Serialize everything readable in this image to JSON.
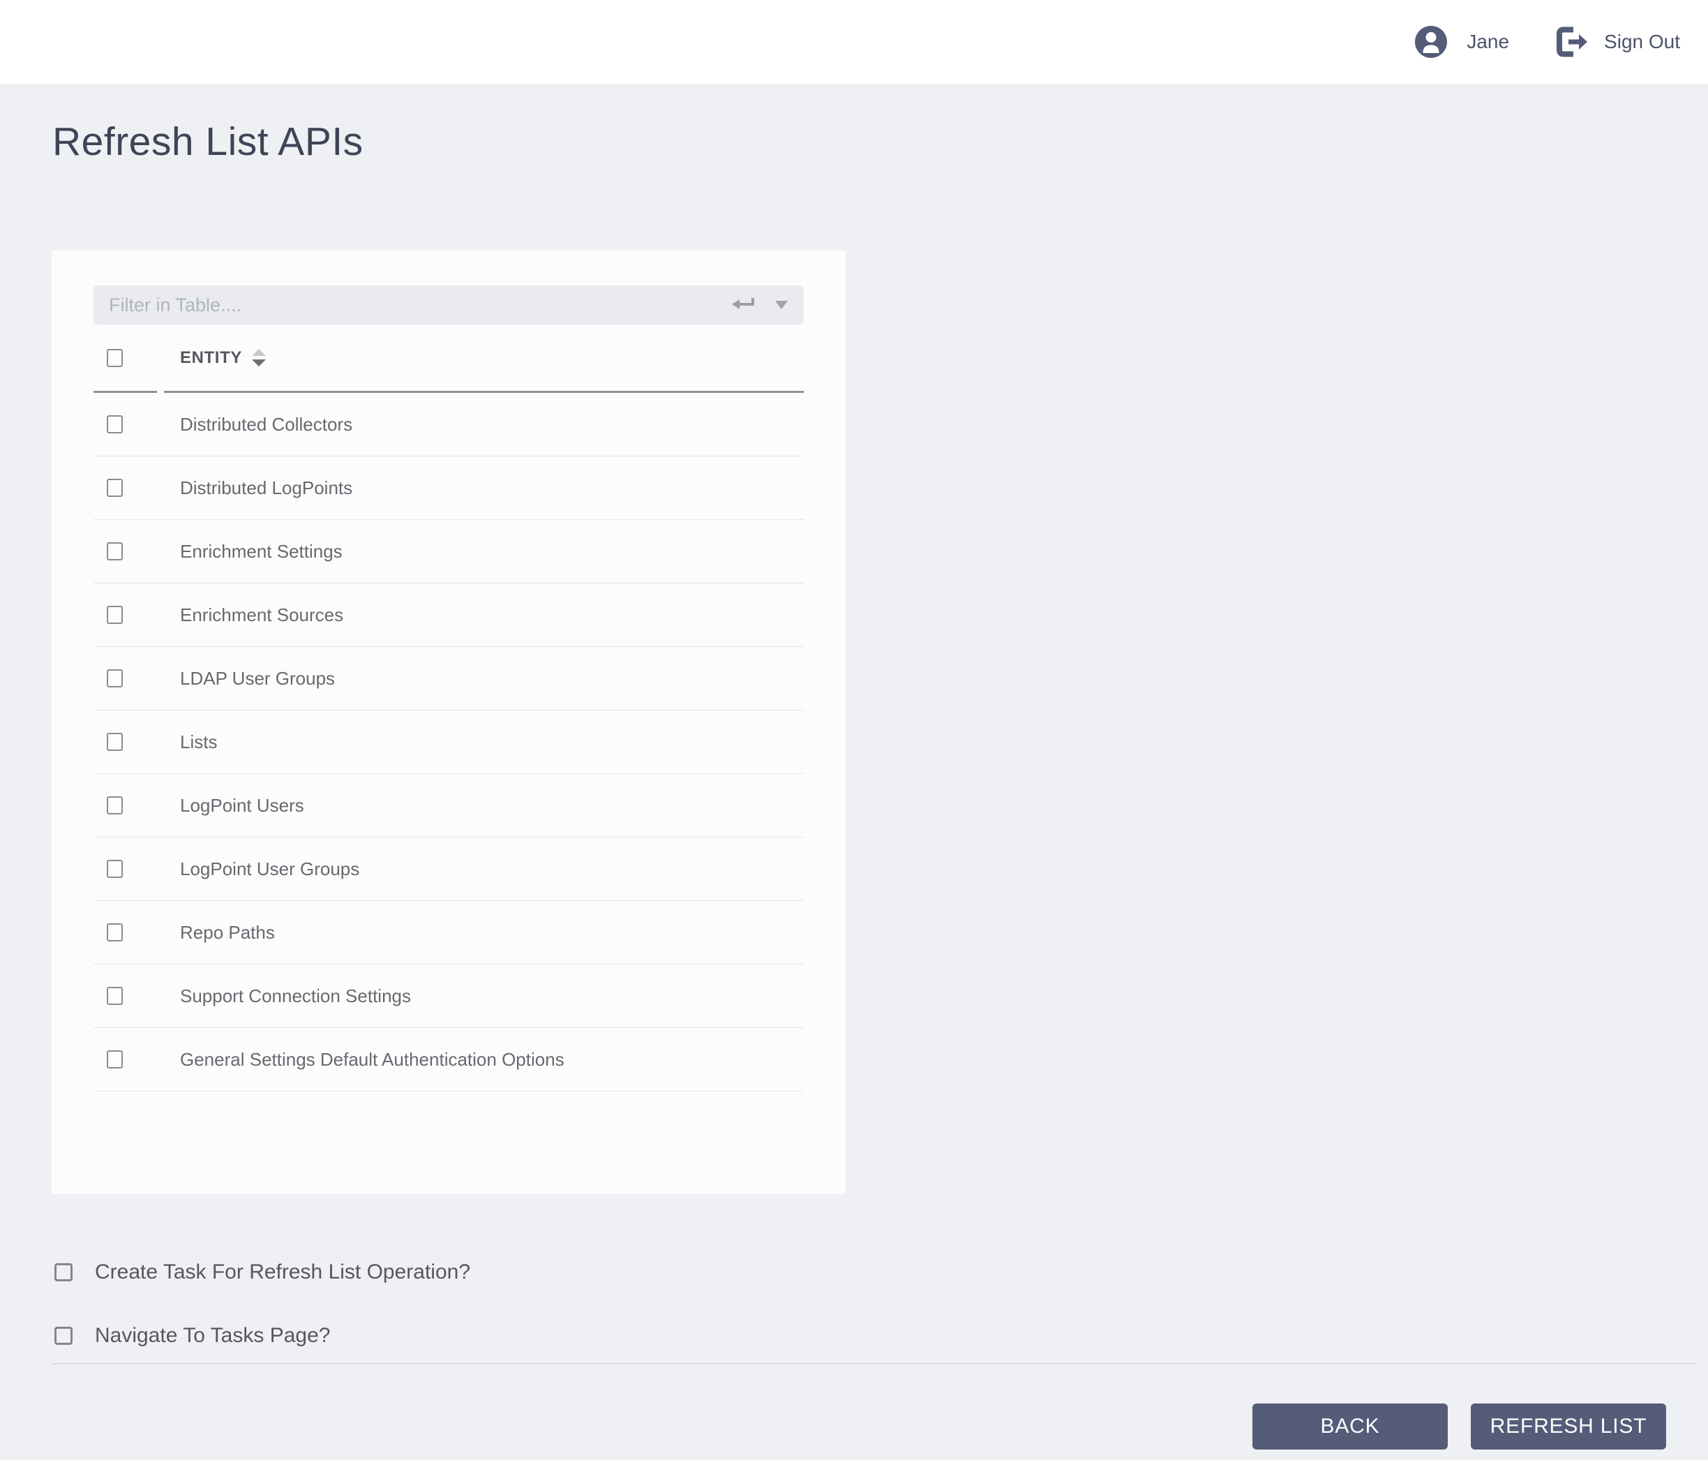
{
  "header": {
    "user_name": "Jane",
    "sign_out_label": "Sign Out"
  },
  "page_title": "Refresh List APIs",
  "panel": {
    "filter": {
      "placeholder": "Filter in Table...."
    },
    "table": {
      "column_header": "ENTITY",
      "rows": [
        {
          "label": "Distributed Collectors",
          "checked": false
        },
        {
          "label": "Distributed LogPoints",
          "checked": false
        },
        {
          "label": "Enrichment Settings",
          "checked": false
        },
        {
          "label": "Enrichment Sources",
          "checked": false
        },
        {
          "label": "LDAP User Groups",
          "checked": false
        },
        {
          "label": "Lists",
          "checked": false
        },
        {
          "label": "LogPoint Users",
          "checked": false
        },
        {
          "label": "LogPoint User Groups",
          "checked": false
        },
        {
          "label": "Repo Paths",
          "checked": false
        },
        {
          "label": "Support Connection Settings",
          "checked": false
        },
        {
          "label": "General Settings Default Authentication Options",
          "checked": false
        }
      ]
    }
  },
  "options": [
    {
      "label": "Create Task For Refresh List Operation?",
      "checked": false
    },
    {
      "label": "Navigate To Tasks Page?",
      "checked": false
    }
  ],
  "footer": {
    "back_label": "BACK",
    "refresh_label": "REFRESH LIST"
  },
  "icons": {
    "user": "user-avatar-icon",
    "sign_out": "sign-out-icon",
    "filter_submit": "return-enter-icon",
    "filter_dropdown": "caret-down-icon",
    "column_sort": "sort-arrows-icon"
  },
  "colors": {
    "accent": "#545c78",
    "page_background": "#eef0f4",
    "card_background": "#fcfcfd",
    "input_background": "#e9ebf0",
    "header_underline": "#8f9092"
  }
}
